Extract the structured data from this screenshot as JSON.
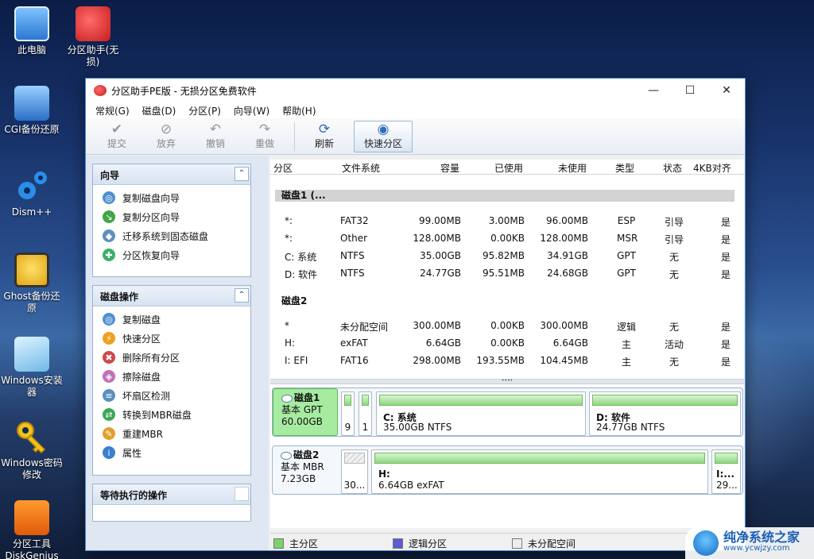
{
  "desktop": {
    "icons": [
      {
        "label": "此电脑",
        "icon": "computer-icon"
      },
      {
        "label": "分区助手(无损)",
        "icon": "partition-assistant-icon"
      },
      {
        "label": "CGI备份还原",
        "icon": "cgi-backup-icon"
      },
      {
        "label": "Dism++",
        "icon": "dism-gear-icon"
      },
      {
        "label": "Ghost备份还原",
        "icon": "ghost-icon"
      },
      {
        "label": "Windows安装器",
        "icon": "windows-installer-icon"
      },
      {
        "label": "Windows密码修改",
        "icon": "key-icon"
      },
      {
        "label": "分区工具DiskGenius",
        "icon": "diskgenius-icon"
      }
    ]
  },
  "window": {
    "title": "分区助手PE版 - 无损分区免费软件",
    "controls": {
      "minimize": "—",
      "maximize": "☐",
      "close": "✕"
    }
  },
  "menu": [
    "常规(G)",
    "磁盘(D)",
    "分区(P)",
    "向导(W)",
    "帮助(H)"
  ],
  "toolbar": {
    "commit": "提交",
    "discard": "放弃",
    "undo": "撤销",
    "redo": "重做",
    "refresh": "刷新",
    "quick_partition": "快速分区"
  },
  "wizard_group": {
    "title": "向导",
    "items": [
      "复制磁盘向导",
      "复制分区向导",
      "迁移系统到固态磁盘",
      "分区恢复向导"
    ]
  },
  "disk_ops_group": {
    "title": "磁盘操作",
    "items": [
      "复制磁盘",
      "快速分区",
      "删除所有分区",
      "擦除磁盘",
      "坏扇区检测",
      "转换到MBR磁盘",
      "重建MBR",
      "属性"
    ]
  },
  "pending_group": {
    "title": "等待执行的操作"
  },
  "columns": [
    "分区",
    "文件系统",
    "容量",
    "已使用",
    "未使用",
    "类型",
    "状态",
    "4KB对齐"
  ],
  "disk1": {
    "header": "磁盘1 (...",
    "partitions": [
      {
        "name": "*:",
        "fs": "FAT32",
        "cap": "99.00MB",
        "used": "3.00MB",
        "free": "96.00MB",
        "type": "ESP",
        "status": "引导",
        "align": "是"
      },
      {
        "name": "*:",
        "fs": "Other",
        "cap": "128.00MB",
        "used": "0.00KB",
        "free": "128.00MB",
        "type": "MSR",
        "status": "引导",
        "align": "是"
      },
      {
        "name": "C: 系统",
        "fs": "NTFS",
        "cap": "35.00GB",
        "used": "95.82MB",
        "free": "34.91GB",
        "type": "GPT",
        "status": "无",
        "align": "是"
      },
      {
        "name": "D: 软件",
        "fs": "NTFS",
        "cap": "24.77GB",
        "used": "95.51MB",
        "free": "24.68GB",
        "type": "GPT",
        "status": "无",
        "align": "是"
      }
    ]
  },
  "disk2": {
    "header": "磁盘2",
    "partitions": [
      {
        "name": "*",
        "fs": "未分配空间",
        "cap": "300.00MB",
        "used": "0.00KB",
        "free": "300.00MB",
        "type": "逻辑",
        "status": "无",
        "align": "是"
      },
      {
        "name": "H:",
        "fs": "exFAT",
        "cap": "6.64GB",
        "used": "0.00KB",
        "free": "6.64GB",
        "type": "主",
        "status": "活动",
        "align": "是"
      },
      {
        "name": "I: EFI",
        "fs": "FAT16",
        "cap": "298.00MB",
        "used": "193.55MB",
        "free": "104.45MB",
        "type": "主",
        "status": "无",
        "align": "是"
      }
    ]
  },
  "diskmap": {
    "disk1": {
      "name": "磁盘1",
      "style": "基本 GPT",
      "size": "60.00GB",
      "p1": "9",
      "p2": "1",
      "c_title": "C: 系统",
      "c_detail": "35.00GB NTFS",
      "d_title": "D: 软件",
      "d_detail": "24.77GB NTFS"
    },
    "disk2": {
      "name": "磁盘2",
      "style": "基本 MBR",
      "size": "7.23GB",
      "p1": "30...",
      "h_title": "H:",
      "h_detail": "6.64GB exFAT",
      "i_title": "I:...",
      "i_detail": "29..."
    }
  },
  "legend": {
    "primary": "主分区",
    "logical": "逻辑分区",
    "unallocated": "未分配空间"
  },
  "watermark": {
    "name": "纯净系统之家",
    "url": "www.ycwjzy.com"
  },
  "colors": {
    "primary": "#7cd36c",
    "logical": "#5b5bd6",
    "unallocated": "#eeeeee",
    "accent": "#2d6fb8"
  }
}
